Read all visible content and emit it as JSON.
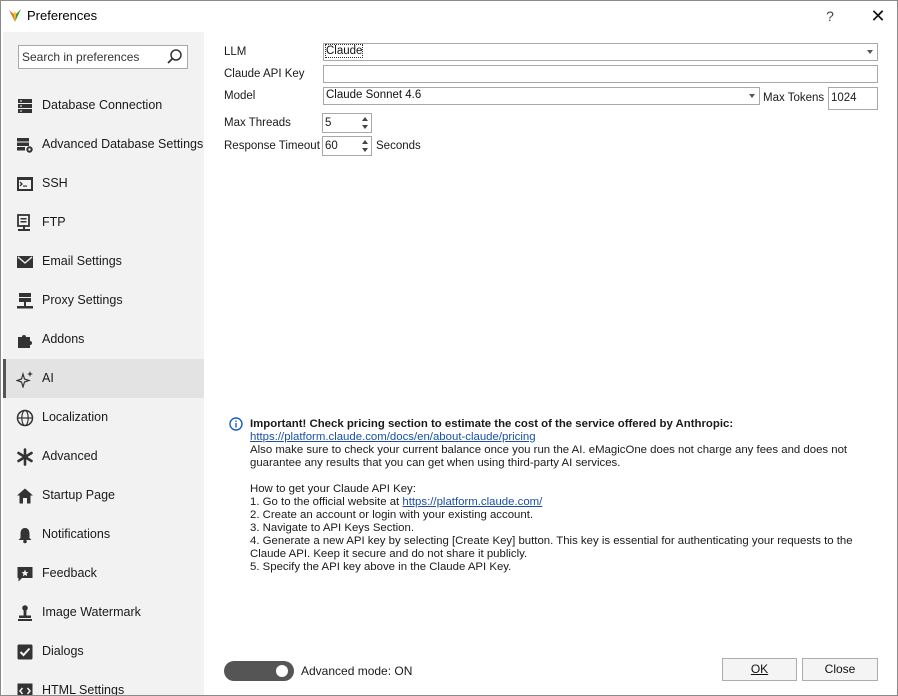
{
  "window": {
    "title": "Preferences",
    "help_label": "?",
    "close_label": "✕"
  },
  "sidebar": {
    "search_placeholder": "Search in preferences",
    "items": [
      {
        "label": "Database Connection",
        "icon": "database-icon"
      },
      {
        "label": "Advanced Database Settings",
        "icon": "database-settings-icon"
      },
      {
        "label": "SSH",
        "icon": "terminal-icon"
      },
      {
        "label": "FTP",
        "icon": "ftp-icon"
      },
      {
        "label": "Email Settings",
        "icon": "envelope-icon"
      },
      {
        "label": "Proxy Settings",
        "icon": "proxy-icon"
      },
      {
        "label": "Addons",
        "icon": "puzzle-icon"
      },
      {
        "label": "AI",
        "icon": "sparkle-icon",
        "active": true
      },
      {
        "label": "Localization",
        "icon": "globe-icon"
      },
      {
        "label": "Advanced",
        "icon": "asterisk-icon"
      },
      {
        "label": "Startup Page",
        "icon": "home-icon"
      },
      {
        "label": "Notifications",
        "icon": "bell-icon"
      },
      {
        "label": "Feedback",
        "icon": "feedback-icon"
      },
      {
        "label": "Image Watermark",
        "icon": "watermark-icon"
      },
      {
        "label": "Dialogs",
        "icon": "checkbox-icon"
      },
      {
        "label": "HTML Settings",
        "icon": "html-icon"
      }
    ]
  },
  "form": {
    "llm_label": "LLM",
    "llm_value": "Claude",
    "api_key_label": "Claude API Key",
    "api_key_value": "",
    "model_label": "Model",
    "model_value": "Claude Sonnet 4.6",
    "max_tokens_label": "Max Tokens",
    "max_tokens_value": "1024",
    "max_threads_label": "Max Threads",
    "max_threads_value": "5",
    "timeout_label": "Response Timeout",
    "timeout_value": "60",
    "timeout_unit": "Seconds"
  },
  "info": {
    "heading": "Important! Check pricing section to estimate the cost of the service offered by Anthropic:",
    "pricing_link": "https://platform.claude.com/docs/en/about-claude/pricing",
    "balance_note": "Also make sure to check your current balance once you run the AI. eMagicOne does not charge any fees and does not guarantee any results that you can get when using third-party AI services.",
    "howto_title": "How to get your Claude API Key:",
    "step1_prefix": "1. Go to the official website at ",
    "step1_link": "https://platform.claude.com/",
    "step2": "2. Create an account or login with your existing account.",
    "step3": "3. Navigate to API Keys Section.",
    "step4": "4. Generate a new API key by selecting [Create Key] button. This key is essential for authenticating your requests to the Claude API. Keep it secure and do not share it publicly.",
    "step5": "5. Specify the API key above in the Claude API Key."
  },
  "footer": {
    "advanced_mode_label": "Advanced mode: ON",
    "ok_label": "OK",
    "close_label": "Close"
  },
  "colors": {
    "sidebar_bg": "#f2f2f2",
    "active_item_bg": "#e3e3e3",
    "link": "#1a4fa3",
    "toggle_bg": "#555555"
  }
}
